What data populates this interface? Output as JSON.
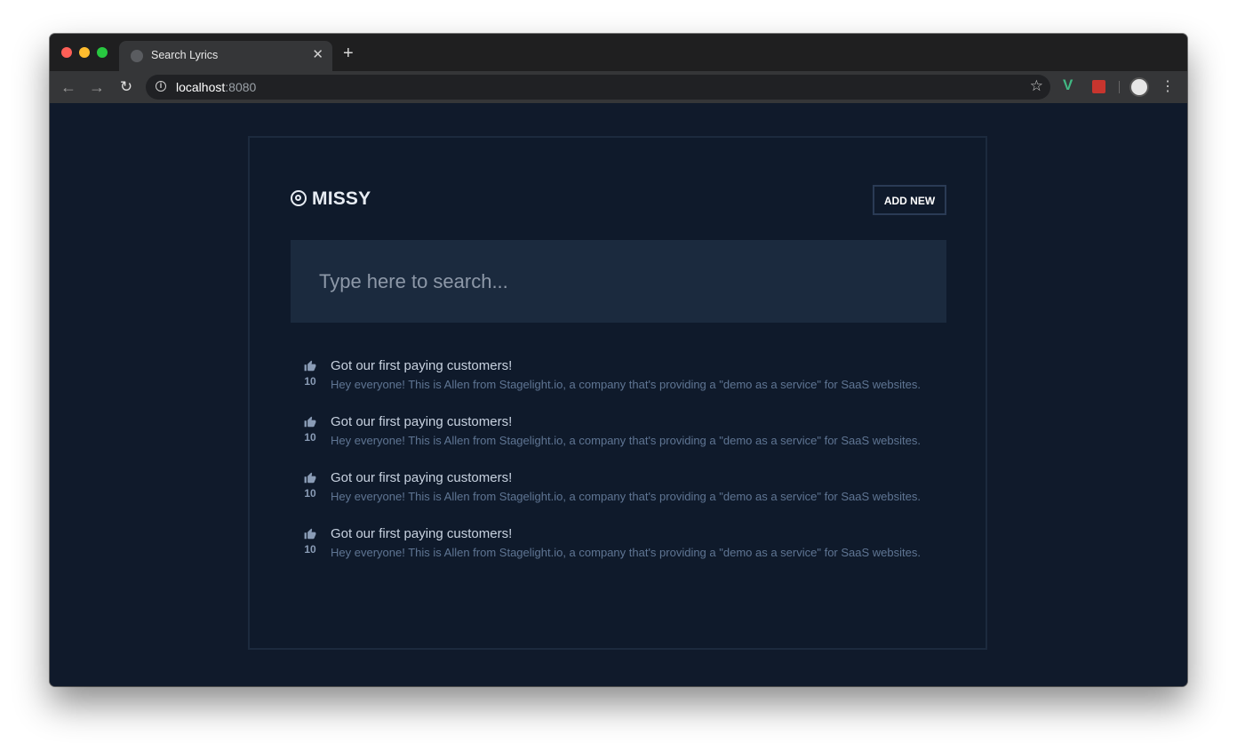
{
  "browser": {
    "tab_title": "Search Lyrics",
    "tab_close": "✕",
    "new_tab": "+",
    "url_host": "localhost",
    "url_port": ":8080"
  },
  "app": {
    "brand": "MISSY",
    "add_button": "ADD NEW",
    "search_placeholder": "Type here to search...",
    "items": [
      {
        "title": "Got our first paying customers!",
        "votes": "10",
        "description": "Hey everyone! This is Allen from Stagelight.io, a company that's providing a \"demo as a service\" for SaaS websites."
      },
      {
        "title": "Got our first paying customers!",
        "votes": "10",
        "description": "Hey everyone! This is Allen from Stagelight.io, a company that's providing a \"demo as a service\" for SaaS websites."
      },
      {
        "title": "Got our first paying customers!",
        "votes": "10",
        "description": "Hey everyone! This is Allen from Stagelight.io, a company that's providing a \"demo as a service\" for SaaS websites."
      },
      {
        "title": "Got our first paying customers!",
        "votes": "10",
        "description": "Hey everyone! This is Allen from Stagelight.io, a company that's providing a \"demo as a service\" for SaaS websites."
      }
    ]
  },
  "icons": {
    "logo": "target-icon",
    "vote": "thumbs-up-icon"
  },
  "colors": {
    "background": "#101a2b",
    "search_bg": "#1b2a3e",
    "title_text": "#c8d2e0",
    "description_text": "#5f7593"
  }
}
